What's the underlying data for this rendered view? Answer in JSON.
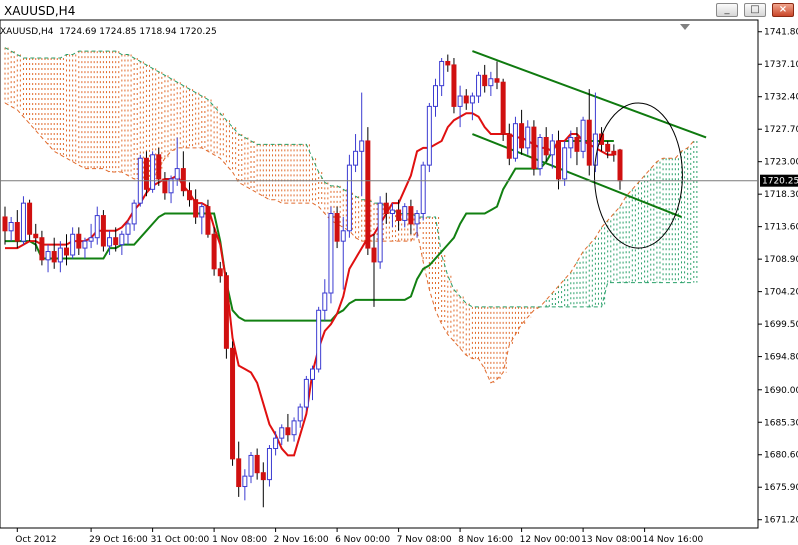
{
  "window": {
    "title": "XAUUSD,H4",
    "minimize_glyph": "_",
    "maximize_glyph": "□",
    "close_glyph": "×"
  },
  "infoline": "XAUUSD,H4  1724.69 1724.85 1718.94 1720.25",
  "colors": {
    "bull_body": "#ffffff",
    "bull_outline": "#3b3bd1",
    "bear_body": "#d01010",
    "tenkan": "#e01010",
    "kijun": "#128012",
    "kumo_bear": "#e06a2c",
    "kumo_bull": "#2aa06a",
    "channel": "#0f7a0f",
    "current_line": "#7a7a7a"
  },
  "chart_data": {
    "type": "candlestick",
    "symbol": "XAUUSD",
    "timeframe": "H4",
    "current_price": "1720.25",
    "ylim": [
      1670.0,
      1743.5
    ],
    "y_ticks": [
      "1741.80",
      "1737.10",
      "1732.40",
      "1727.70",
      "1723.00",
      "1718.30",
      "1713.60",
      "1708.90",
      "1704.20",
      "1699.50",
      "1694.80",
      "1690.00",
      "1685.30",
      "1680.60",
      "1675.90",
      "1671.20"
    ],
    "x_ticks": [
      {
        "i": 2,
        "label": "Oct 2012"
      },
      {
        "i": 14,
        "label": "29 Oct 16:00"
      },
      {
        "i": 24,
        "label": "31 Oct 00:00"
      },
      {
        "i": 34,
        "label": "1 Nov 08:00"
      },
      {
        "i": 44,
        "label": "2 Nov 16:00"
      },
      {
        "i": 54,
        "label": "6 Nov 00:00"
      },
      {
        "i": 64,
        "label": "7 Nov 08:00"
      },
      {
        "i": 74,
        "label": "8 Nov 16:00"
      },
      {
        "i": 84,
        "label": "12 Nov 00:00"
      },
      {
        "i": 94,
        "label": "13 Nov 08:00"
      },
      {
        "i": 104,
        "label": "14 Nov 16:00"
      }
    ],
    "candles": [
      [
        1715.0,
        1716.5,
        1711.0,
        1713.0
      ],
      [
        1713.0,
        1715.0,
        1711.5,
        1714.2
      ],
      [
        1714.2,
        1716.0,
        1710.5,
        1711.5
      ],
      [
        1711.5,
        1718.0,
        1711.0,
        1717.0
      ],
      [
        1717.0,
        1717.5,
        1711.5,
        1712.5
      ],
      [
        1712.5,
        1714.0,
        1710.0,
        1712.0
      ],
      [
        1712.0,
        1713.0,
        1708.0,
        1708.8
      ],
      [
        1708.8,
        1711.0,
        1707.0,
        1710.0
      ],
      [
        1710.0,
        1712.0,
        1707.5,
        1708.5
      ],
      [
        1708.5,
        1711.5,
        1707.0,
        1710.5
      ],
      [
        1710.5,
        1712.5,
        1708.0,
        1709.5
      ],
      [
        1709.5,
        1713.5,
        1709.0,
        1712.5
      ],
      [
        1712.5,
        1713.5,
        1709.5,
        1710.5
      ],
      [
        1710.5,
        1712.0,
        1709.0,
        1711.5
      ],
      [
        1711.5,
        1714.0,
        1710.5,
        1712.0
      ],
      [
        1712.0,
        1716.5,
        1711.0,
        1715.2
      ],
      [
        1715.2,
        1716.0,
        1710.0,
        1710.8
      ],
      [
        1710.8,
        1713.0,
        1709.5,
        1712.0
      ],
      [
        1712.0,
        1713.5,
        1710.0,
        1711.0
      ],
      [
        1711.0,
        1713.0,
        1709.5,
        1712.5
      ],
      [
        1712.5,
        1714.5,
        1711.0,
        1714.0
      ],
      [
        1714.0,
        1717.5,
        1713.0,
        1717.0
      ],
      [
        1717.0,
        1724.0,
        1716.5,
        1723.5
      ],
      [
        1723.5,
        1724.5,
        1718.0,
        1719.0
      ],
      [
        1719.0,
        1724.5,
        1718.5,
        1724.0
      ],
      [
        1724.0,
        1725.0,
        1719.5,
        1720.5
      ],
      [
        1720.5,
        1721.5,
        1717.5,
        1718.5
      ],
      [
        1718.5,
        1721.0,
        1717.0,
        1720.5
      ],
      [
        1720.5,
        1726.5,
        1719.5,
        1722.0
      ],
      [
        1722.0,
        1724.5,
        1718.0,
        1718.8
      ],
      [
        1718.8,
        1720.0,
        1716.5,
        1717.5
      ],
      [
        1717.5,
        1719.0,
        1714.0,
        1715.0
      ],
      [
        1715.0,
        1717.0,
        1712.5,
        1716.5
      ],
      [
        1716.5,
        1717.5,
        1712.0,
        1712.5
      ],
      [
        1712.5,
        1713.5,
        1706.5,
        1707.5
      ],
      [
        1707.5,
        1708.5,
        1705.5,
        1706.5
      ],
      [
        1706.5,
        1707.0,
        1694.5,
        1696.0
      ],
      [
        1696.0,
        1697.0,
        1679.0,
        1680.0
      ],
      [
        1680.0,
        1682.5,
        1674.5,
        1676.0
      ],
      [
        1676.0,
        1678.5,
        1674.0,
        1677.5
      ],
      [
        1677.5,
        1681.0,
        1676.5,
        1680.5
      ],
      [
        1680.5,
        1681.5,
        1677.0,
        1678.0
      ],
      [
        1678.0,
        1679.5,
        1673.0,
        1677.0
      ],
      [
        1677.0,
        1682.0,
        1676.0,
        1681.5
      ],
      [
        1681.5,
        1684.0,
        1680.5,
        1683.0
      ],
      [
        1683.0,
        1685.0,
        1682.0,
        1684.5
      ],
      [
        1684.5,
        1686.5,
        1682.5,
        1683.5
      ],
      [
        1683.5,
        1686.0,
        1682.5,
        1685.5
      ],
      [
        1685.5,
        1688.0,
        1684.5,
        1687.5
      ],
      [
        1687.5,
        1692.0,
        1687.0,
        1691.5
      ],
      [
        1691.5,
        1693.5,
        1688.5,
        1693.0
      ],
      [
        1693.0,
        1702.0,
        1692.5,
        1701.5
      ],
      [
        1701.5,
        1706.0,
        1700.0,
        1704.0
      ],
      [
        1704.0,
        1716.5,
        1702.5,
        1715.5
      ],
      [
        1715.5,
        1716.5,
        1710.5,
        1711.5
      ],
      [
        1711.5,
        1715.0,
        1704.5,
        1713.0
      ],
      [
        1713.0,
        1724.0,
        1712.0,
        1722.5
      ],
      [
        1722.5,
        1727.0,
        1721.5,
        1724.5
      ],
      [
        1724.5,
        1733.0,
        1718.0,
        1726.0
      ],
      [
        1726.0,
        1728.0,
        1709.5,
        1710.5
      ],
      [
        1710.5,
        1712.5,
        1702.0,
        1708.5
      ],
      [
        1708.5,
        1718.0,
        1707.5,
        1717.0
      ],
      [
        1717.0,
        1718.5,
        1714.0,
        1715.5
      ],
      [
        1715.5,
        1717.0,
        1713.5,
        1716.0
      ],
      [
        1716.0,
        1717.5,
        1713.0,
        1714.5
      ],
      [
        1714.5,
        1717.0,
        1713.5,
        1716.5
      ],
      [
        1716.5,
        1717.5,
        1712.5,
        1714.0
      ],
      [
        1714.0,
        1716.0,
        1712.0,
        1715.5
      ],
      [
        1715.5,
        1723.0,
        1714.5,
        1722.5
      ],
      [
        1722.5,
        1731.5,
        1721.5,
        1731.0
      ],
      [
        1731.0,
        1735.0,
        1729.5,
        1734.0
      ],
      [
        1734.0,
        1738.0,
        1732.5,
        1737.5
      ],
      [
        1737.5,
        1738.5,
        1736.0,
        1737.0
      ],
      [
        1737.0,
        1738.0,
        1730.0,
        1731.0
      ],
      [
        1731.0,
        1734.0,
        1728.0,
        1732.5
      ],
      [
        1732.5,
        1733.5,
        1730.5,
        1731.5
      ],
      [
        1731.5,
        1733.0,
        1729.0,
        1732.5
      ],
      [
        1732.5,
        1736.0,
        1731.5,
        1735.5
      ],
      [
        1735.5,
        1737.0,
        1733.0,
        1734.0
      ],
      [
        1734.0,
        1736.0,
        1732.5,
        1735.0
      ],
      [
        1735.0,
        1737.5,
        1733.5,
        1734.5
      ],
      [
        1734.5,
        1735.0,
        1726.0,
        1727.0
      ],
      [
        1727.0,
        1728.5,
        1722.5,
        1723.5
      ],
      [
        1723.5,
        1729.5,
        1723.0,
        1728.5
      ],
      [
        1728.5,
        1730.5,
        1724.0,
        1725.0
      ],
      [
        1725.0,
        1729.0,
        1724.0,
        1728.0
      ],
      [
        1728.0,
        1729.0,
        1721.0,
        1722.0
      ],
      [
        1722.0,
        1727.0,
        1721.0,
        1726.5
      ],
      [
        1726.5,
        1728.0,
        1723.0,
        1724.0
      ],
      [
        1724.0,
        1727.0,
        1722.0,
        1726.0
      ],
      [
        1726.0,
        1727.5,
        1719.0,
        1720.5
      ],
      [
        1720.5,
        1726.0,
        1719.5,
        1725.0
      ],
      [
        1725.0,
        1727.5,
        1723.5,
        1726.5
      ],
      [
        1726.5,
        1728.0,
        1722.5,
        1724.5
      ],
      [
        1724.5,
        1729.5,
        1723.5,
        1729.0
      ],
      [
        1729.0,
        1733.5,
        1721.0,
        1722.5
      ],
      [
        1722.5,
        1733.0,
        1721.5,
        1727.0
      ],
      [
        1727.0,
        1728.0,
        1724.5,
        1725.5
      ],
      [
        1725.5,
        1726.0,
        1723.5,
        1724.5
      ],
      [
        1724.5,
        1725.5,
        1723.0,
        1724.0
      ],
      [
        1724.69,
        1724.85,
        1718.94,
        1720.25
      ]
    ],
    "tenkan": [
      1710.5,
      1710.5,
      1710.5,
      1711.0,
      1711.5,
      1711.5,
      1711.0,
      1711.0,
      1711.0,
      1711.0,
      1711.0,
      1711.5,
      1711.5,
      1711.5,
      1712.0,
      1713.0,
      1713.0,
      1713.0,
      1713.0,
      1713.5,
      1714.5,
      1716.0,
      1717.0,
      1718.5,
      1719.5,
      1720.0,
      1720.5,
      1720.5,
      1721.0,
      1719.5,
      1718.5,
      1717.0,
      1717.0,
      1716.5,
      1713.5,
      1711.0,
      1705.5,
      1697.5,
      1693.5,
      1693.0,
      1692.5,
      1691.0,
      1688.0,
      1685.0,
      1683.5,
      1681.5,
      1680.5,
      1680.5,
      1683.5,
      1686.5,
      1692.5,
      1696.0,
      1698.5,
      1699.5,
      1701.0,
      1703.5,
      1707.5,
      1709.0,
      1710.5,
      1712.0,
      1712.5,
      1714.0,
      1715.5,
      1717.0,
      1717.0,
      1719.0,
      1721.0,
      1724.5,
      1725.0,
      1725.0,
      1725.5,
      1726.0,
      1728.0,
      1729.0,
      1729.5,
      1730.0,
      1730.0,
      1729.5,
      1728.0,
      1727.0,
      1727.0,
      1727.0,
      1727.0,
      1726.5,
      1726.5,
      1726.0,
      1725.5,
      1725.0,
      1725.0,
      1724.5,
      1726.0,
      1726.0,
      1727.0,
      1727.0,
      1726.0,
      1725.5,
      1725.0,
      1724.5,
      1724.0,
      1724.0
    ],
    "kijun": [
      1711.5,
      1711.5,
      1711.5,
      1711.5,
      1711.5,
      1711.0,
      1709.0,
      1709.0,
      1709.0,
      1709.0,
      1709.0,
      1709.0,
      1709.0,
      1709.0,
      1709.0,
      1709.0,
      1709.0,
      1710.5,
      1710.5,
      1711.0,
      1711.0,
      1711.0,
      1712.0,
      1713.0,
      1714.0,
      1715.0,
      1715.5,
      1715.5,
      1715.5,
      1715.5,
      1715.5,
      1715.5,
      1715.5,
      1715.5,
      1715.5,
      1711.5,
      1705.5,
      1701.5,
      1700.5,
      1700.0,
      1700.0,
      1700.0,
      1700.0,
      1700.0,
      1700.0,
      1700.0,
      1700.0,
      1700.0,
      1700.0,
      1700.0,
      1700.0,
      1700.0,
      1700.0,
      1700.0,
      1701.0,
      1701.5,
      1702.5,
      1703.0,
      1703.0,
      1703.0,
      1703.0,
      1703.0,
      1703.0,
      1703.0,
      1703.0,
      1703.0,
      1703.5,
      1706.0,
      1707.5,
      1708.0,
      1709.0,
      1710.0,
      1711.0,
      1712.0,
      1714.0,
      1715.5,
      1715.5,
      1715.5,
      1715.5,
      1716.0,
      1716.5,
      1719.0,
      1720.5,
      1722.0,
      1722.0,
      1722.0,
      1722.0,
      1722.0,
      1723.0,
      1724.5,
      1726.0,
      1726.0,
      1726.0,
      1726.0,
      1726.0,
      1726.0,
      1726.0,
      1726.0,
      1726.0,
      1726.0
    ],
    "cloud": {
      "start_i": 0,
      "span_a": [
        1731.5,
        1731.0,
        1730.5,
        1729.5,
        1728.5,
        1727.5,
        1726.5,
        1725.5,
        1724.5,
        1724.0,
        1723.5,
        1723.0,
        1722.5,
        1722.0,
        1722.0,
        1722.0,
        1722.0,
        1721.5,
        1721.5,
        1721.5,
        1721.0,
        1720.5,
        1720.5,
        1720.5,
        1720.5,
        1722.0,
        1723.5,
        1724.5,
        1725.0,
        1725.0,
        1725.0,
        1725.0,
        1725.0,
        1724.5,
        1724.0,
        1723.5,
        1722.5,
        1721.5,
        1720.0,
        1719.5,
        1719.0,
        1718.5,
        1718.0,
        1717.5,
        1717.5,
        1717.0,
        1717.0,
        1717.0,
        1717.0,
        1717.0,
        1717.0,
        1716.5,
        1715.5,
        1714.5,
        1714.0,
        1713.5,
        1713.0,
        1712.0,
        1711.5,
        1711.5,
        1711.5,
        1711.5,
        1711.5,
        1711.5,
        1711.5,
        1711.5,
        1711.5,
        1713.0,
        1708.5,
        1704.5,
        1701.5,
        1699.5,
        1698.0,
        1697.0,
        1696.0,
        1695.0,
        1694.5,
        1694.5,
        1693.0,
        1691.0,
        1691.5,
        1692.5,
        1696.5,
        1698.0,
        1699.5,
        1700.5,
        1701.5,
        1702.0,
        1703.0,
        1704.0,
        1705.0,
        1706.0,
        1707.0,
        1708.5,
        1710.0,
        1711.0,
        1712.0,
        1713.5,
        1714.5,
        1715.5,
        1716.5,
        1718.0,
        1719.0,
        1720.0,
        1721.0,
        1722.0,
        1723.0,
        1723.5,
        1723.5,
        1723.5,
        1724.5,
        1725.0,
        1726.0
      ],
      "span_b": [
        1739.5,
        1739.0,
        1738.5,
        1738.0,
        1738.0,
        1738.0,
        1738.0,
        1738.0,
        1738.0,
        1738.0,
        1738.5,
        1738.5,
        1739.0,
        1739.0,
        1739.0,
        1739.0,
        1739.0,
        1739.0,
        1739.0,
        1738.5,
        1738.5,
        1738.0,
        1737.5,
        1737.0,
        1736.5,
        1736.0,
        1735.5,
        1735.0,
        1734.5,
        1734.0,
        1733.5,
        1733.0,
        1732.5,
        1732.0,
        1731.0,
        1730.0,
        1729.0,
        1728.0,
        1727.0,
        1726.5,
        1726.0,
        1725.5,
        1725.5,
        1725.5,
        1725.5,
        1725.5,
        1725.5,
        1725.5,
        1725.5,
        1725.5,
        1723.5,
        1721.5,
        1720.0,
        1719.5,
        1719.5,
        1719.0,
        1718.5,
        1718.0,
        1717.5,
        1717.5,
        1717.0,
        1717.0,
        1716.5,
        1716.0,
        1715.5,
        1715.5,
        1715.5,
        1715.0,
        1715.0,
        1715.0,
        1715.0,
        1709.5,
        1706.5,
        1704.5,
        1703.5,
        1702.5,
        1702.0,
        1702.0,
        1702.0,
        1702.0,
        1702.0,
        1702.0,
        1702.0,
        1702.0,
        1702.0,
        1702.0,
        1702.0,
        1702.0,
        1702.0,
        1702.0,
        1702.0,
        1702.0,
        1702.0,
        1702.0,
        1702.0,
        1702.0,
        1702.0,
        1702.0,
        1705.5,
        1705.5,
        1705.5,
        1705.5,
        1705.5,
        1705.5,
        1705.5,
        1705.5,
        1705.5,
        1705.5,
        1705.5,
        1705.5,
        1705.5,
        1705.5,
        1705.5
      ]
    },
    "channel": {
      "upper": [
        [
          76,
          1739.0
        ],
        [
          114,
          1726.5
        ]
      ],
      "lower": [
        [
          76,
          1727.0
        ],
        [
          110,
          1715.0
        ]
      ]
    },
    "annotation": {
      "type": "ellipse",
      "center": [
        103,
        1721.0
      ],
      "radius_x_bars": 6.5,
      "radius_y_price": 10.5
    }
  }
}
